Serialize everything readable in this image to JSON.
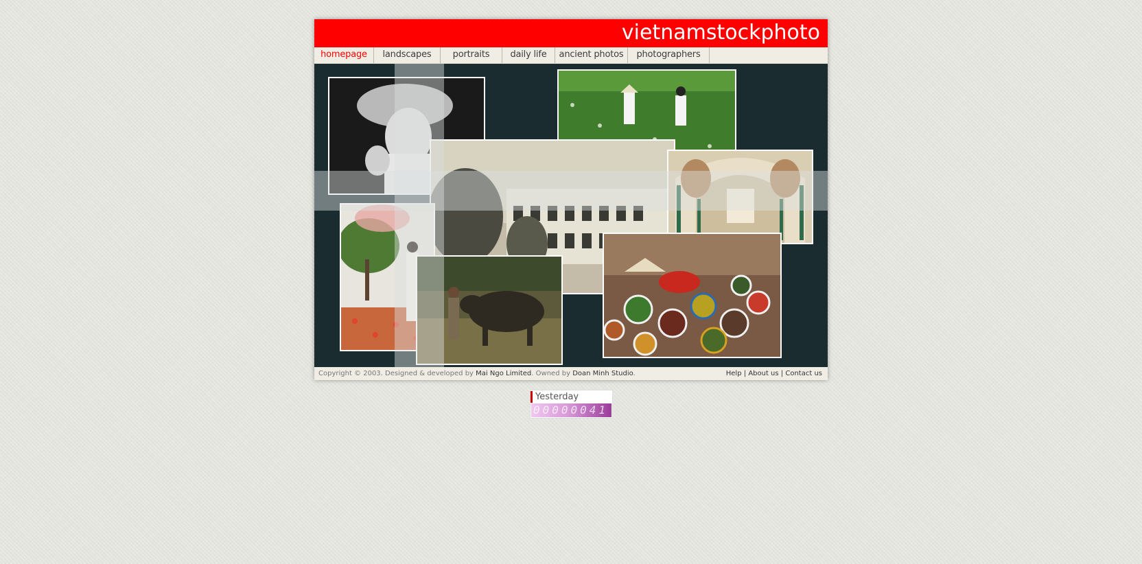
{
  "header": {
    "site_title": "vietnamstockphoto"
  },
  "nav": {
    "items": [
      {
        "label": "homepage",
        "active": true
      },
      {
        "label": "landscapes",
        "active": false
      },
      {
        "label": "portraits",
        "active": false
      },
      {
        "label": "daily life",
        "active": false
      },
      {
        "label": "ancient photos",
        "active": false
      },
      {
        "label": "photographers",
        "active": false
      }
    ]
  },
  "footer": {
    "copyright_prefix": "Copyright © 2003. Designed & developed by",
    "developer": "Mai Ngo Limited",
    "owned_by_prefix": ". Owned by",
    "owner": "Doan Minh Studio",
    "owner_suffix": ".",
    "links": {
      "help": "Help",
      "about": "About us",
      "contact": "Contact us",
      "separator": "|"
    }
  },
  "counter": {
    "label": "Yesterday",
    "value": "00000041"
  },
  "colors": {
    "brand_red": "#ff0000",
    "stage_bg": "#1b2c30",
    "nav_bg": "#efede4"
  }
}
